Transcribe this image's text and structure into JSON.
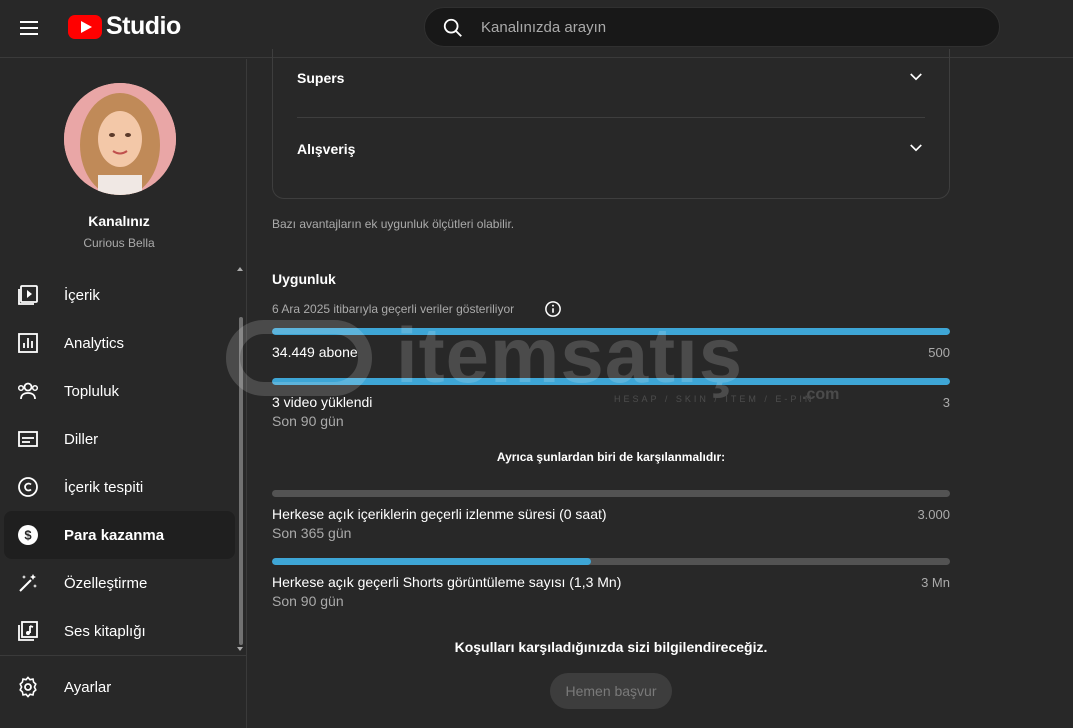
{
  "header": {
    "logo_text": "Studio",
    "search_placeholder": "Kanalınızda arayın"
  },
  "sidebar": {
    "channel_title": "Kanalınız",
    "channel_name": "Curious Bella",
    "items": [
      {
        "label": "İçerik",
        "icon": "content-icon"
      },
      {
        "label": "Analytics",
        "icon": "analytics-icon"
      },
      {
        "label": "Topluluk",
        "icon": "community-icon"
      },
      {
        "label": "Diller",
        "icon": "subtitles-icon"
      },
      {
        "label": "İçerik tespiti",
        "icon": "copyright-icon"
      },
      {
        "label": "Para kazanma",
        "icon": "dollar-icon",
        "active": true
      },
      {
        "label": "Özelleştirme",
        "icon": "magic-wand-icon"
      },
      {
        "label": "Ses kitaplığı",
        "icon": "audio-library-icon"
      }
    ],
    "settings_label": "Ayarlar"
  },
  "main": {
    "accordion": [
      {
        "label": "Supers"
      },
      {
        "label": "Alışveriş"
      }
    ],
    "note": "Bazı avantajların ek uygunluk ölçütleri olabilir.",
    "eligibility_title": "Uygunluk",
    "as_of": "6 Ara 2025 itibarıyla geçerli veriler gösteriliyor",
    "requirements": [
      {
        "label": "34.449 abone",
        "sub": "",
        "target": "500",
        "progress": 1.0
      },
      {
        "label": "3 video yüklendi",
        "sub": "Son 90 gün",
        "target": "3",
        "progress": 1.0
      }
    ],
    "also_required": "Ayrıca şunlardan biri de karşılanmalıdır:",
    "alternatives": [
      {
        "label": "Herkese açık içeriklerin geçerli izlenme süresi (0 saat)",
        "sub": "Son 365 gün",
        "target": "3.000",
        "progress": 0.0
      },
      {
        "label": "Herkese açık geçerli Shorts görüntüleme sayısı (1,3 Mn)",
        "sub": "Son 90 gün",
        "target": "3 Mn",
        "progress": 0.47
      }
    ],
    "notify": "Koşulları karşıladığınızda sizi bilgilendireceğiz.",
    "apply_label": "Hemen başvur"
  },
  "watermark": {
    "text": "itemsatış",
    "sub": "HESAP / SKIN / ITEM / E-PIN",
    "com": ".com"
  },
  "colors": {
    "progress_fill": "#3ea6d6",
    "progress_track": "#535353",
    "accent_red": "#ff0000"
  }
}
